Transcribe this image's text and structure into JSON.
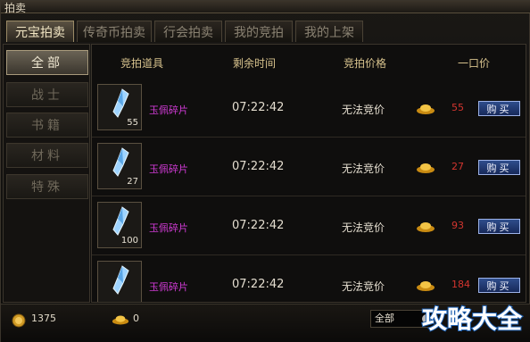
{
  "window": {
    "title": "拍卖"
  },
  "tabs": [
    {
      "label": "元宝拍卖",
      "active": true
    },
    {
      "label": "传奇币拍卖",
      "active": false
    },
    {
      "label": "行会拍卖",
      "active": false
    },
    {
      "label": "我的竞拍",
      "active": false
    },
    {
      "label": "我的上架",
      "active": false
    }
  ],
  "categories": [
    {
      "label": "全部",
      "active": true
    },
    {
      "label": "战士",
      "active": false
    },
    {
      "label": "书籍",
      "active": false
    },
    {
      "label": "材料",
      "active": false
    },
    {
      "label": "特殊",
      "active": false
    }
  ],
  "table": {
    "headers": {
      "item": "竞拍道具",
      "time": "剩余时间",
      "bid": "竞拍价格",
      "buyout": "一口价"
    },
    "rows": [
      {
        "name": "玉佩碎片",
        "qty": "55",
        "time": "07:22:42",
        "bid_status": "无法竞价",
        "price": "55",
        "buy_label": "购买"
      },
      {
        "name": "玉佩碎片",
        "qty": "27",
        "time": "07:22:42",
        "bid_status": "无法竞价",
        "price": "27",
        "buy_label": "购买"
      },
      {
        "name": "玉佩碎片",
        "qty": "100",
        "time": "07:22:42",
        "bid_status": "无法竞价",
        "price": "93",
        "buy_label": "购买"
      },
      {
        "name": "玉佩碎片",
        "qty": "",
        "time": "07:22:42",
        "bid_status": "无法竞价",
        "price": "184",
        "buy_label": "购买"
      }
    ]
  },
  "footer": {
    "gold": "1375",
    "yuanbao": "0",
    "filter_value": "全部",
    "watermark": "攻略大全"
  },
  "colors": {
    "item_name": "#d23bd6",
    "price": "#d3352f",
    "buy_button": "#1f3a78",
    "header_text": "#d7c28d"
  },
  "icons": [
    "crystal-shard-icon",
    "gold-ingot-icon",
    "gold-coin-icon",
    "dropdown-icon"
  ]
}
